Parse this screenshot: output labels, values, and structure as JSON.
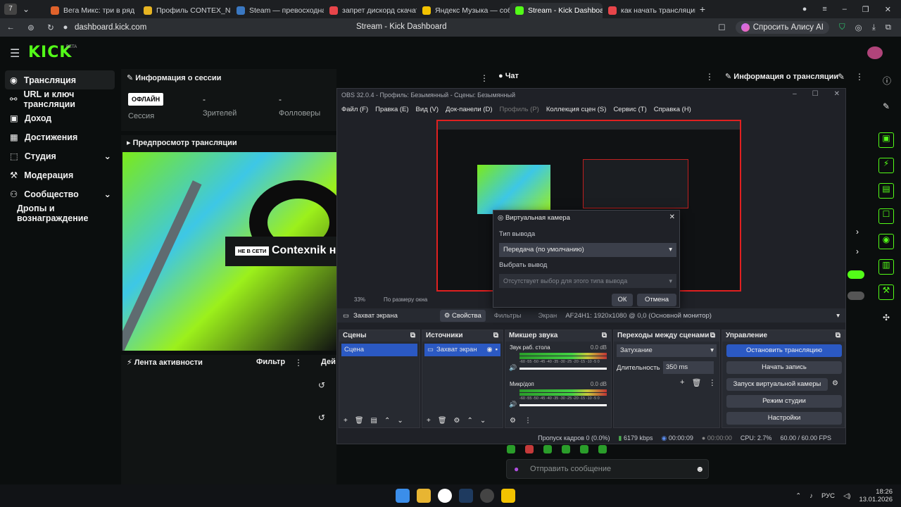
{
  "browser": {
    "tabs": [
      {
        "title": "Вега Микс: три в ряд",
        "color": "#e0622b"
      },
      {
        "title": "Профиль CONTEX_NIK",
        "color": "#e6b422"
      },
      {
        "title": "Steam — превосходная и",
        "color": "#3a78c2"
      },
      {
        "title": "запрет дискорд скачать -",
        "color": "#e8454a"
      },
      {
        "title": "Яндекс Музыка — собира",
        "color": "#f2c200"
      },
      {
        "title": "Stream - Kick Dashboard",
        "color": "#53fc18"
      },
      {
        "title": "как начать трансляцию н",
        "color": "#e8454a"
      }
    ],
    "url": "dashboard.kick.com",
    "page_title": "Stream - Kick Dashboard",
    "alice_label": "Спросить Алису AI"
  },
  "kick": {
    "logo": "KICK",
    "logo_badge": "BETA",
    "nav": [
      {
        "label": "Трансляция",
        "icon": "broadcast-icon"
      },
      {
        "label": "URL и ключ трансляции",
        "icon": "link-icon"
      },
      {
        "label": "Доход",
        "icon": "money-icon"
      },
      {
        "label": "Достижения",
        "icon": "trophy-icon"
      },
      {
        "label": "Студия",
        "icon": "studio-icon"
      },
      {
        "label": "Модерация",
        "icon": "hammer-icon"
      },
      {
        "label": "Сообщество",
        "icon": "people-icon"
      },
      {
        "label": "Дропы и вознаграждение",
        "icon": ""
      }
    ],
    "session_title": "Информация о сессии",
    "status_badge": "ОФЛАЙН",
    "stats": [
      {
        "value": "",
        "label": "Сессия"
      },
      {
        "value": "-",
        "label": "Зрителей"
      },
      {
        "value": "-",
        "label": "Фолловеры"
      }
    ],
    "preview_title": "Предпросмотр трансляции",
    "offline_badge": "НЕ В СЕТИ",
    "channel_name": "Contexnik н",
    "activity_title": "Лента активности",
    "filter_label": "Фильтр",
    "actions_label": "Дей",
    "chat_title": "Чат",
    "stream_info_title": "Информация о трансляции",
    "chat_input_placeholder": "Отправить сообщение"
  },
  "obs": {
    "title": "OBS 32.0.4 - Профиль: Безымянный - Сцены: Безымянный",
    "menu": [
      "Файл (F)",
      "Правка (E)",
      "Вид (V)",
      "Док-панели (D)",
      "Профиль (P)",
      "Коллекция сцен (S)",
      "Сервис (T)",
      "Справка (H)"
    ],
    "zoom": "33%",
    "zoom_mode": "По размеру окна",
    "source_bar": {
      "source": "Захват экрана",
      "properties": "Свойства",
      "filters": "Фильтры",
      "screen_label": "Экран",
      "screen_value": "AF24H1: 1920x1080 @ 0,0 (Основной монитор)"
    },
    "docks": {
      "scenes": "Сцены",
      "sources": "Источники",
      "mixer": "Микшер звука",
      "transitions": "Переходы между сценами",
      "controls": "Управление"
    },
    "scene_item": "Сцена",
    "source_item": "Захват экран",
    "mixer": [
      {
        "name": "Звук раб. стола",
        "db": "0.0 dB"
      },
      {
        "name": "Микр/доп",
        "db": "0.0 dB"
      }
    ],
    "meter_ticks": "-60 -55 -50 -45 -40 -35 -30 -25 -20 -15 -10 -5 0",
    "transition": "Затухание",
    "duration_label": "Длительность",
    "duration_value": "350 ms",
    "controls": [
      "Остановить трансляцию",
      "Начать запись",
      "Запуск виртуальной камеры",
      "Режим студии",
      "Настройки"
    ],
    "status": {
      "dropped": "Пропуск кадров 0 (0.0%)",
      "bitrate": "6179 kbps",
      "stream_time": "00:00:09",
      "rec_time": "00:00:00",
      "cpu": "CPU: 2.7%",
      "fps": "60.00 / 60.00 FPS"
    },
    "dialog": {
      "title": "Виртуальная камера",
      "type_label": "Тип вывода",
      "type_value": "Передача (по умолчанию)",
      "output_label": "Выбрать вывод",
      "output_value": "Отсутствует выбор для этого типа вывода",
      "ok": "ОК",
      "cancel": "Отмена"
    }
  },
  "taskbar": {
    "lang": "РУС",
    "time": "18:26",
    "date": "13.01.2026"
  }
}
